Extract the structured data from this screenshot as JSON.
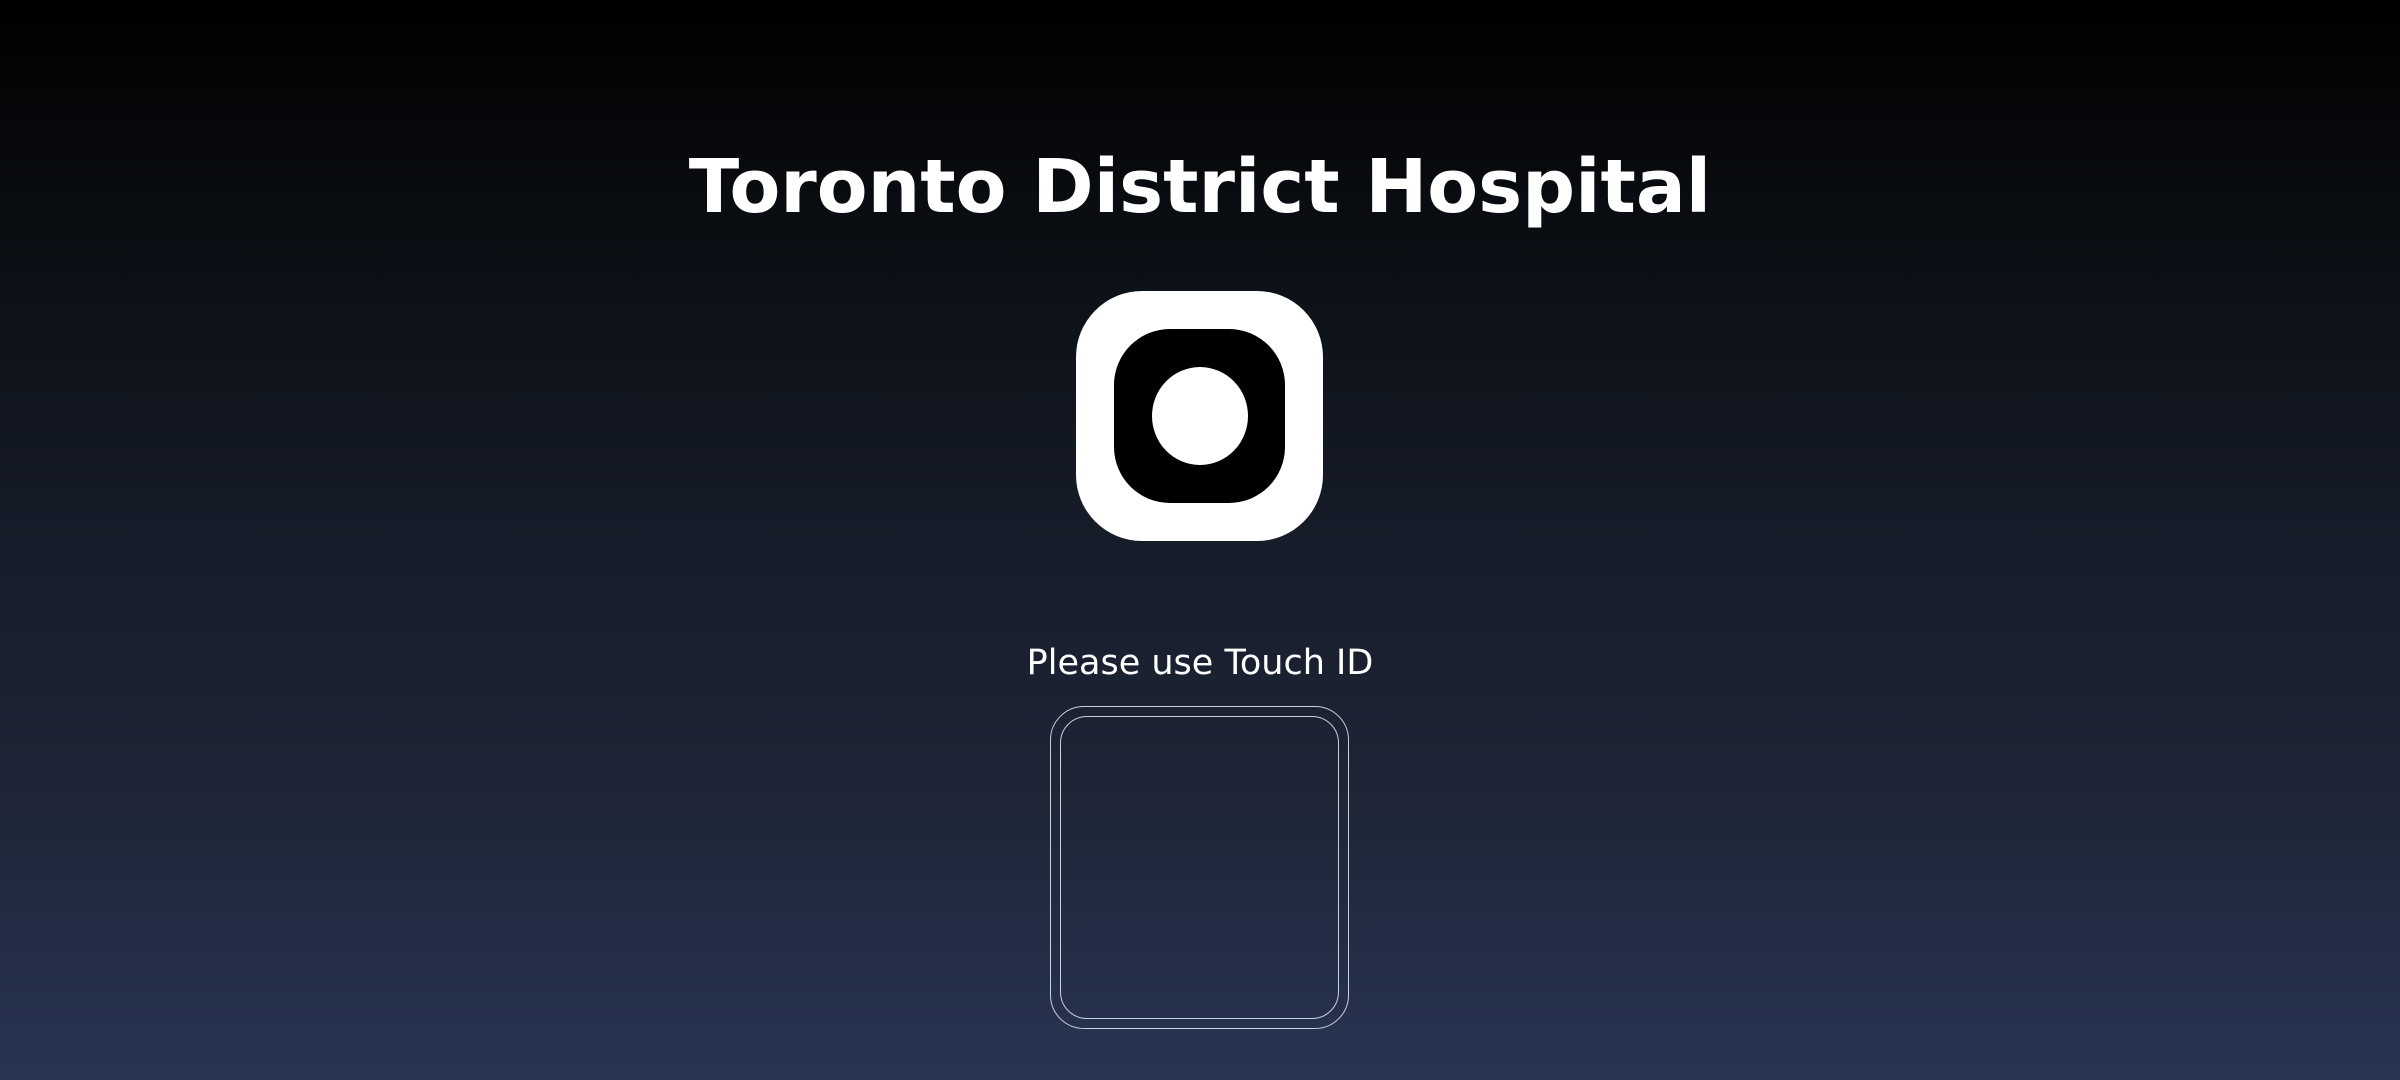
{
  "header": {
    "title": "Toronto District Hospital"
  },
  "app_icon": {
    "icon": "app-logo-icon",
    "colors": {
      "outer": "#ffffff",
      "inner": "#000000"
    }
  },
  "auth": {
    "prompt": "Please use Touch ID",
    "sensor_icon": "fingerprint-sensor-area"
  },
  "theme": {
    "background_top": "#000000",
    "background_bottom": "#283453",
    "outline": "#c9cfdb",
    "text": "#ffffff"
  }
}
